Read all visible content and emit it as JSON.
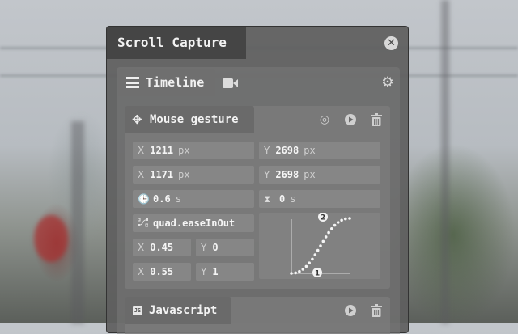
{
  "window": {
    "title": "Scroll Capture"
  },
  "tabs": {
    "timeline": "Timeline"
  },
  "gesture": {
    "title": "Mouse gesture",
    "start": {
      "x_key": "X",
      "x": "1211",
      "x_unit": "px",
      "y_key": "Y",
      "y": "2698",
      "y_unit": "px"
    },
    "end": {
      "x_key": "X",
      "x": "1171",
      "x_unit": "px",
      "y_key": "Y",
      "y": "2698",
      "y_unit": "px"
    },
    "duration": {
      "value": "0.6",
      "unit": "s"
    },
    "delay": {
      "value": "0",
      "unit": "s"
    },
    "easing": "quad.easeInOut",
    "cp1": {
      "x_key": "X",
      "x": "0.45",
      "y_key": "Y",
      "y": "0"
    },
    "cp2": {
      "x_key": "X",
      "x": "0.55",
      "y_key": "Y",
      "y": "1"
    },
    "curve_markers": [
      "1",
      "2"
    ]
  },
  "script_card": {
    "title": "Javascript",
    "icon_text": "JS"
  }
}
